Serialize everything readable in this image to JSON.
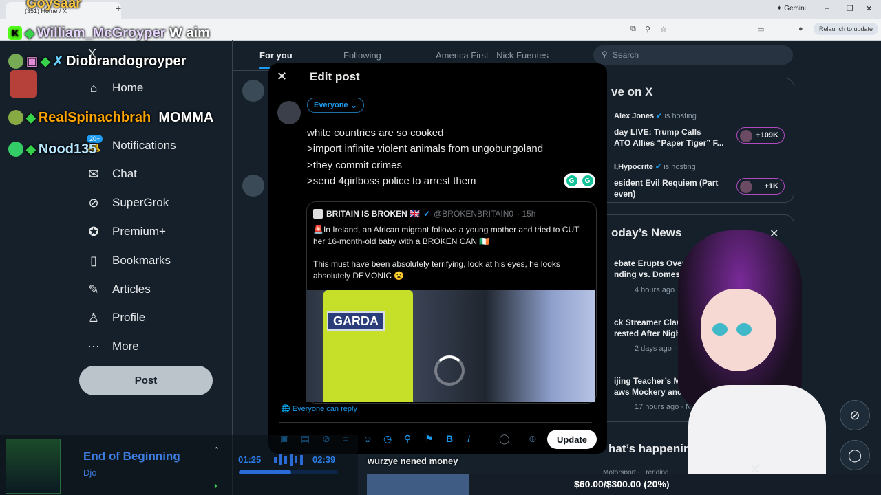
{
  "browser": {
    "tab_label": "(351) Home / X",
    "gemini_label": "Gemini",
    "relaunch_label": "Relaunch to update"
  },
  "chat": [
    {
      "user": "Goysaar",
      "message": ""
    },
    {
      "user": "William_McGroyper",
      "message": "W aim"
    },
    {
      "user": "Diobrandogroyper",
      "message": ""
    },
    {
      "user": "RealSpinachbrah",
      "message": "MOMMA"
    },
    {
      "user": "Nood135",
      "message": ""
    }
  ],
  "nav": {
    "items": [
      {
        "label": "Home",
        "icon": "home-icon"
      },
      {
        "label": "Notifications",
        "icon": "bell-icon",
        "badge": "20+"
      },
      {
        "label": "Chat",
        "icon": "mail-icon"
      },
      {
        "label": "SuperGrok",
        "icon": "grok-icon"
      },
      {
        "label": "Premium+",
        "icon": "verified-icon"
      },
      {
        "label": "Bookmarks",
        "icon": "bookmark-icon"
      },
      {
        "label": "Articles",
        "icon": "articles-icon"
      },
      {
        "label": "Profile",
        "icon": "profile-icon"
      },
      {
        "label": "More",
        "icon": "more-icon"
      }
    ],
    "post_label": "Post",
    "x_logo": "X",
    "dm_badge": "20+"
  },
  "tabs": [
    "For you",
    "Following",
    "America First - Nick Fuentes"
  ],
  "search": {
    "placeholder": "Search"
  },
  "live": {
    "title": "ve on X",
    "hosts": [
      {
        "name": "Alex Jones",
        "status": "is hosting",
        "title": "day LIVE: Trump Calls\nATO Allies “Paper Tiger” F...",
        "count": "+109K"
      },
      {
        "name": "I,Hypocrite",
        "status": "is hosting",
        "title": "esident Evil Requiem (Part\neven)",
        "count": "+1K"
      }
    ]
  },
  "news": {
    "title": "oday’s News",
    "items": [
      {
        "title": "ebate Erupts Over $\nnding vs. Domest",
        "meta": "4 hours ago"
      },
      {
        "title": "ck Streamer Clav\nrested After Nigh",
        "meta": "2 days ago · Other"
      },
      {
        "title": "ijing Teacher’s Money\naws Mockery and Del",
        "meta": "17 hours ago · N"
      }
    ],
    "happening": "hat’s happenin",
    "trending_meta": "Motorsport · Trending"
  },
  "modal": {
    "title": "Edit post",
    "audience": "Everyone",
    "text": "white countries are so cooked\n>import infinite violent animals from ungobungoland\n>they commit crimes\n>send 4girlboss police to arrest them",
    "quote": {
      "name": "BRITAIN IS BROKEN 🇬🇧",
      "handle": "@BROKENBRITAIN0",
      "time": "· 15h",
      "p1": "🚨In Ireland, an African migrant follows a young mother and tried to CUT her 16-month-old baby with a BROKEN CAN 🇮🇪",
      "p2": "This must have been absolutely terrifying, look at his eyes, he looks absolutely DEMONIC 😮",
      "media_text": "GARDA"
    },
    "reply_setting": "Everyone can reply",
    "update_label": "Update"
  },
  "music": {
    "song": "End of Beginning",
    "artist": "Djo",
    "current": "01:25",
    "total": "02:39",
    "progress": 0.53
  },
  "donation": {
    "label": "wurzye nened money",
    "goal_text": "$60.00/$300.00 (20%)",
    "progress": 0.2
  }
}
